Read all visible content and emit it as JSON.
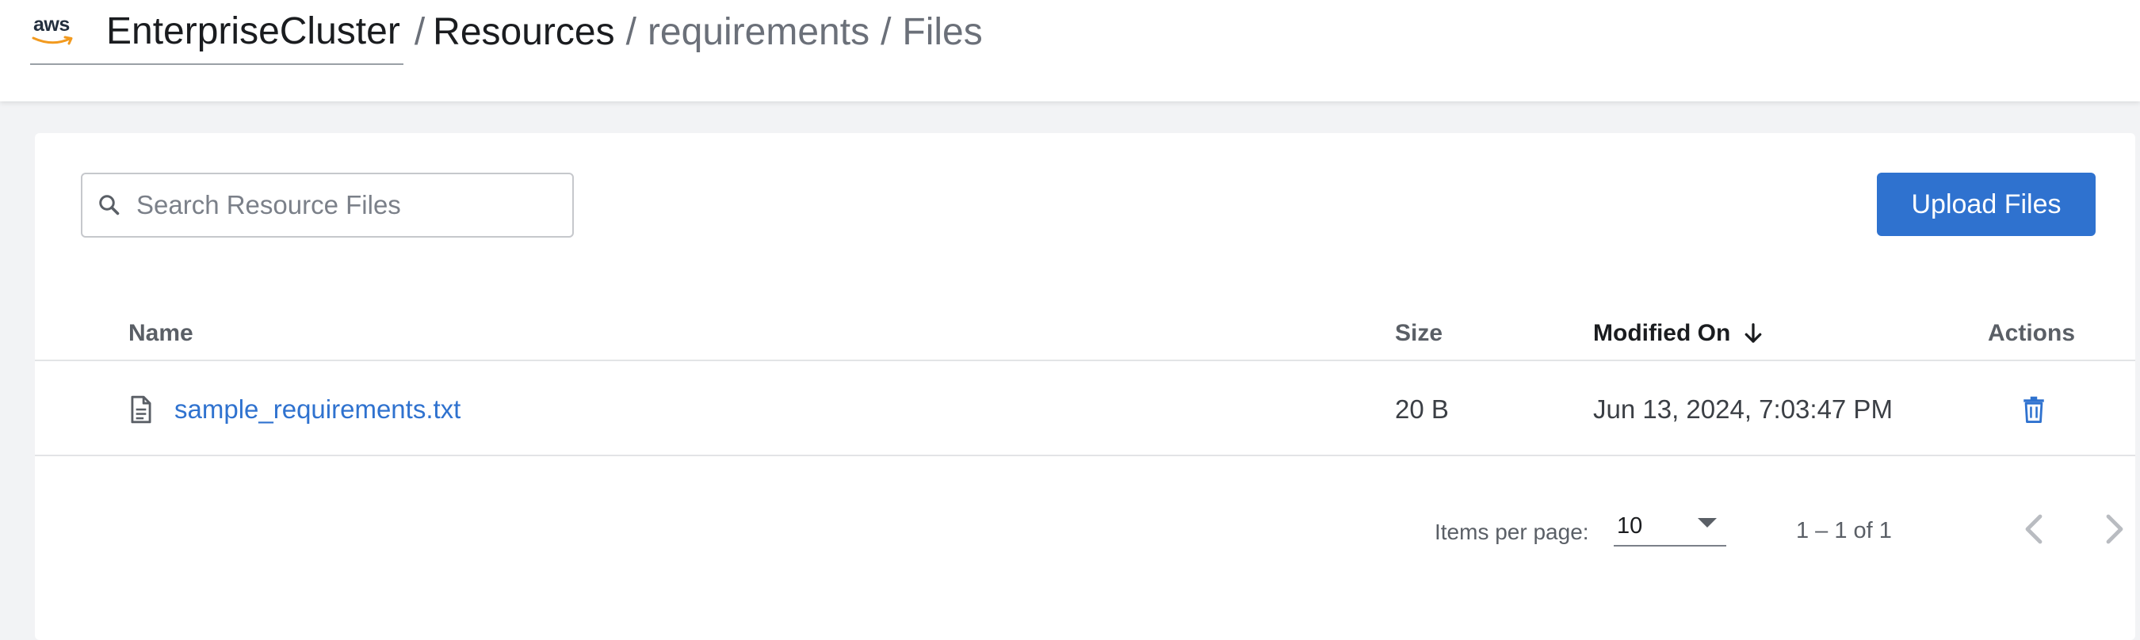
{
  "header": {
    "logo_text": "aws",
    "cluster": "EnterpriseCluster",
    "breadcrumbs": [
      "Resources",
      "requirements",
      "Files"
    ]
  },
  "toolbar": {
    "search_placeholder": "Search Resource Files",
    "search_value": "",
    "upload_label": "Upload Files"
  },
  "table": {
    "columns": {
      "name": "Name",
      "size": "Size",
      "modified": "Modified On",
      "actions": "Actions"
    },
    "sort": {
      "column": "modified",
      "direction": "descending"
    },
    "rows": [
      {
        "name": "sample_requirements.txt",
        "size": "20 B",
        "modified": "Jun 13, 2024, 7:03:47 PM"
      }
    ]
  },
  "paginator": {
    "items_per_page_label": "Items per page:",
    "items_per_page": "10",
    "range": "1 – 1 of 1"
  },
  "colors": {
    "accent": "#2f72cf",
    "background": "#f2f3f5",
    "text": "#1a1c1f",
    "muted": "#6b7079"
  },
  "icons": [
    "search-icon",
    "document-icon",
    "trash-icon",
    "arrow-down-icon",
    "chevron-left-icon",
    "chevron-right-icon"
  ]
}
